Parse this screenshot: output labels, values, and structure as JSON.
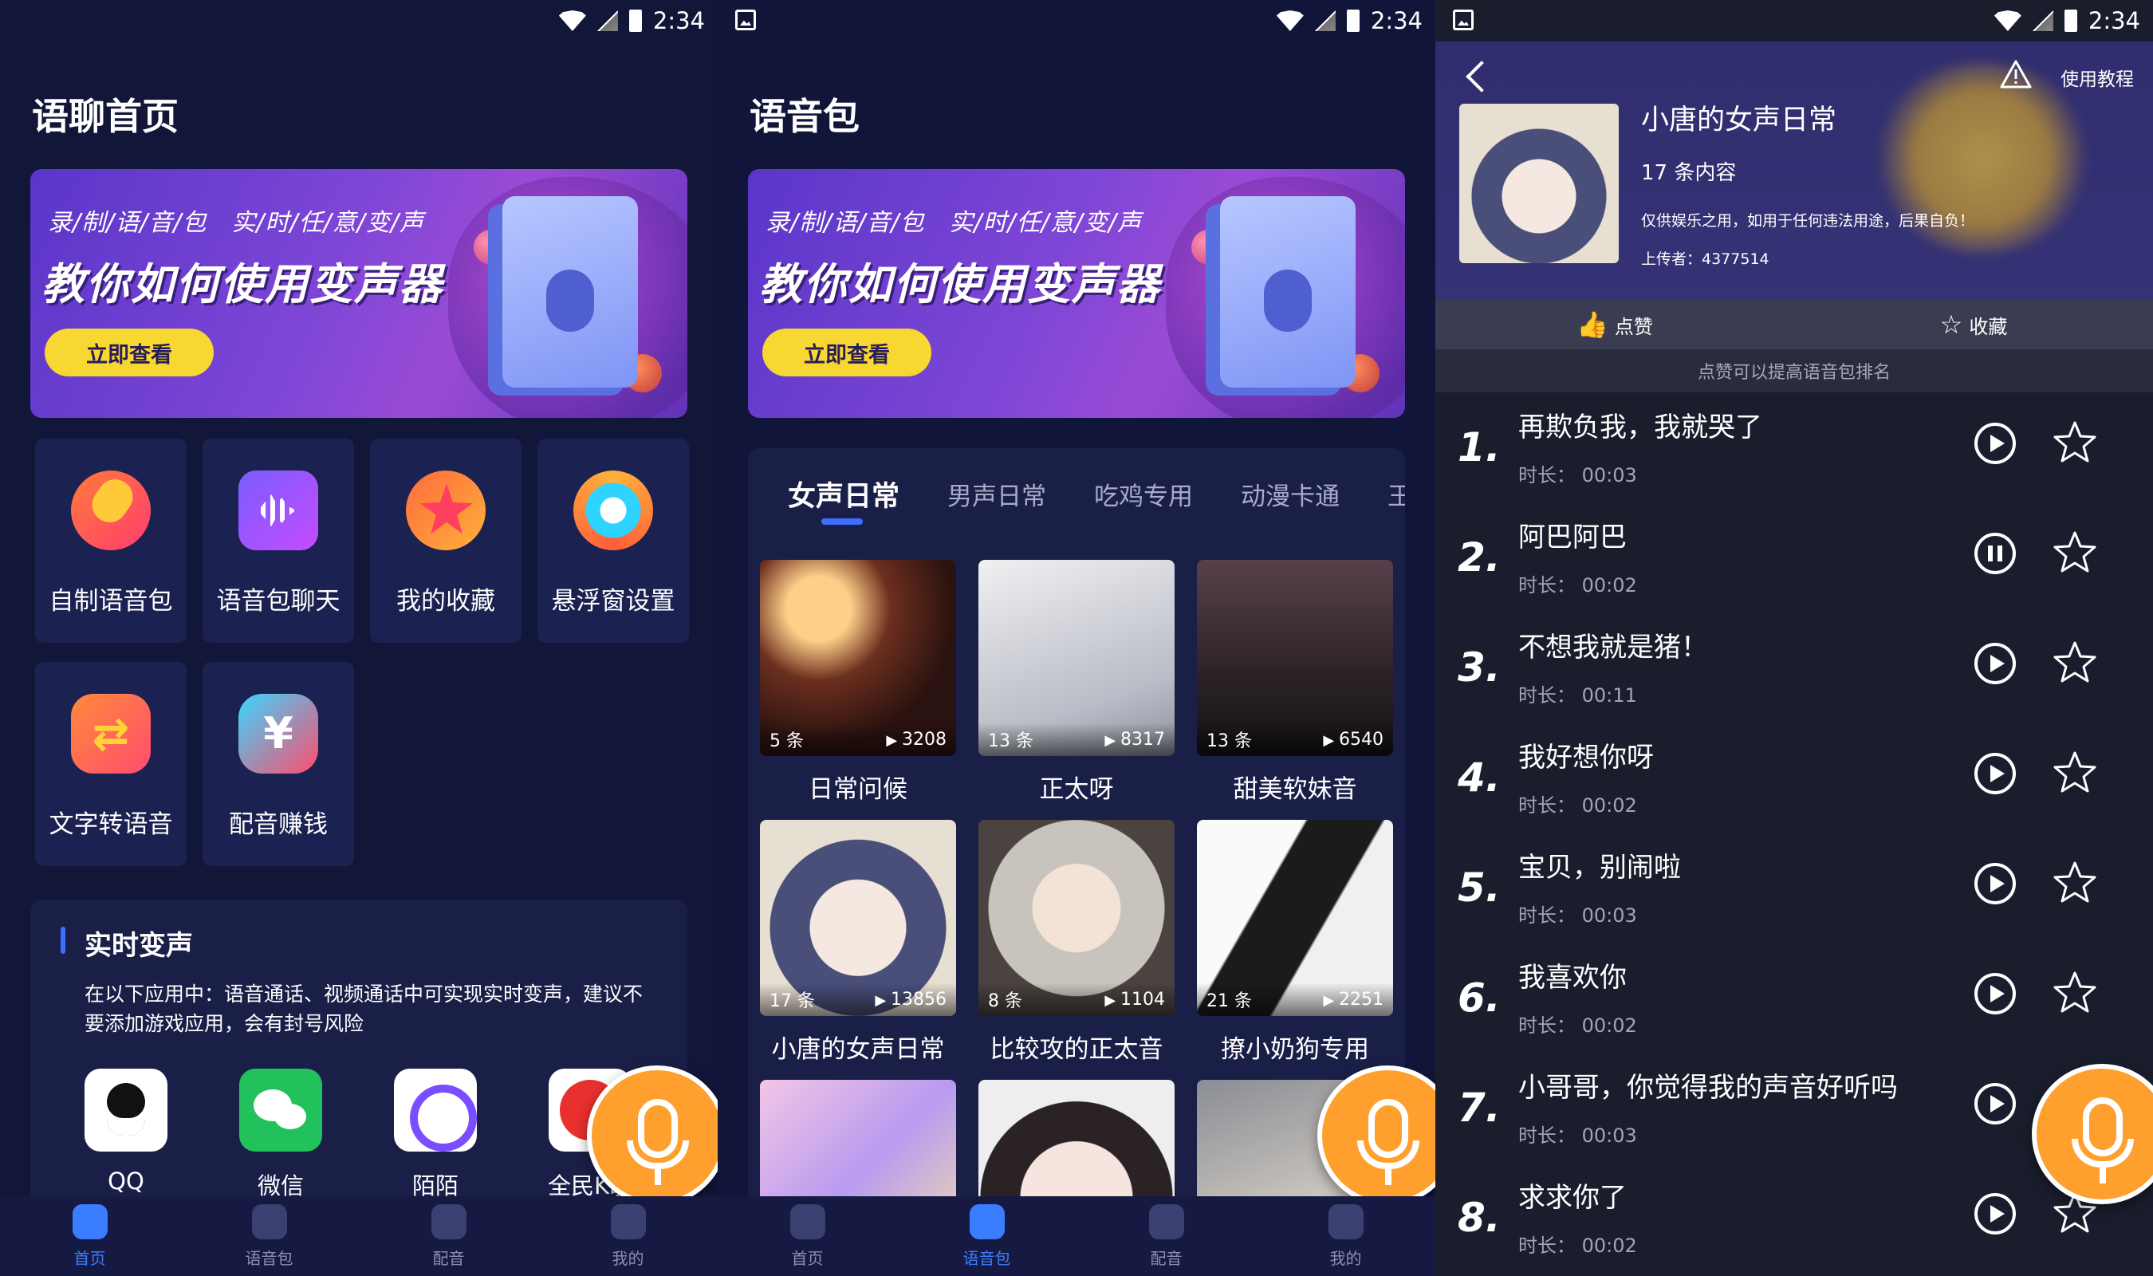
{
  "status_bar": {
    "time": "2:34"
  },
  "screen1": {
    "title": "语聊首页",
    "banner": {
      "subtitle": "录/制/语/音/包　实/时/任/意/变/声",
      "headline": "教你如何使用变声器",
      "button": "立即查看"
    },
    "tiles": [
      {
        "label": "自制语音包",
        "icon": "microphone-icon"
      },
      {
        "label": "语音包聊天",
        "icon": "voice-wave-icon"
      },
      {
        "label": "我的收藏",
        "icon": "star-icon"
      },
      {
        "label": "悬浮窗设置",
        "icon": "gear-icon"
      },
      {
        "label": "文字转语音",
        "icon": "swap-icon"
      },
      {
        "label": "配音赚钱",
        "icon": "money-icon"
      }
    ],
    "realtime": {
      "title": "实时变声",
      "desc": "在以下应用中：语音通话、视频通话中可实现实时变声，建议不要添加游戏应用，会有封号风险",
      "apps": [
        "QQ",
        "微信",
        "陌陌",
        "全民K歌"
      ]
    }
  },
  "screen2": {
    "title": "语音包",
    "banner": {
      "subtitle": "录/制/语/音/包　实/时/任/意/变/声",
      "headline": "教你如何使用变声器",
      "button": "立即查看"
    },
    "categories": [
      "女声日常",
      "男声日常",
      "吃鸡专用",
      "动漫卡通",
      "王者"
    ],
    "cards": [
      {
        "name": "日常问候",
        "count": "5 条",
        "plays": "3208"
      },
      {
        "name": "正太呀",
        "count": "13 条",
        "plays": "8317"
      },
      {
        "name": "甜美软妹音",
        "count": "13 条",
        "plays": "6540"
      },
      {
        "name": "小唐的女声日常",
        "count": "17 条",
        "plays": "13856"
      },
      {
        "name": "比较攻的正太音",
        "count": "8 条",
        "plays": "1104"
      },
      {
        "name": "撩小奶狗专用",
        "count": "21 条",
        "plays": "2251"
      }
    ]
  },
  "screen3": {
    "tutorial": "使用教程",
    "pack_title": "小唐的女声日常",
    "count": "17 条内容",
    "disclaimer": "仅供娱乐之用，如用于任何违法用途，后果自负！",
    "uploader": "上传者：4377514",
    "like": "点赞",
    "favorite": "收藏",
    "hint": "点赞可以提高语音包排名",
    "items": [
      {
        "num": "1.",
        "name": "再欺负我，我就哭了",
        "duration": "时长： 00:03",
        "state": "play"
      },
      {
        "num": "2.",
        "name": "阿巴阿巴",
        "duration": "时长： 00:02",
        "state": "pause"
      },
      {
        "num": "3.",
        "name": "不想我就是猪！",
        "duration": "时长： 00:11",
        "state": "play"
      },
      {
        "num": "4.",
        "name": "我好想你呀",
        "duration": "时长： 00:02",
        "state": "play"
      },
      {
        "num": "5.",
        "name": "宝贝，别闹啦",
        "duration": "时长： 00:03",
        "state": "play"
      },
      {
        "num": "6.",
        "name": "我喜欢你",
        "duration": "时长： 00:02",
        "state": "play"
      },
      {
        "num": "7.",
        "name": "小哥哥，你觉得我的声音好听吗",
        "duration": "时长： 00:03",
        "state": "play"
      },
      {
        "num": "8.",
        "name": "求求你了",
        "duration": "时长： 00:02",
        "state": "play"
      }
    ]
  },
  "tabbar": [
    "首页",
    "语音包",
    "配音",
    "我的"
  ]
}
